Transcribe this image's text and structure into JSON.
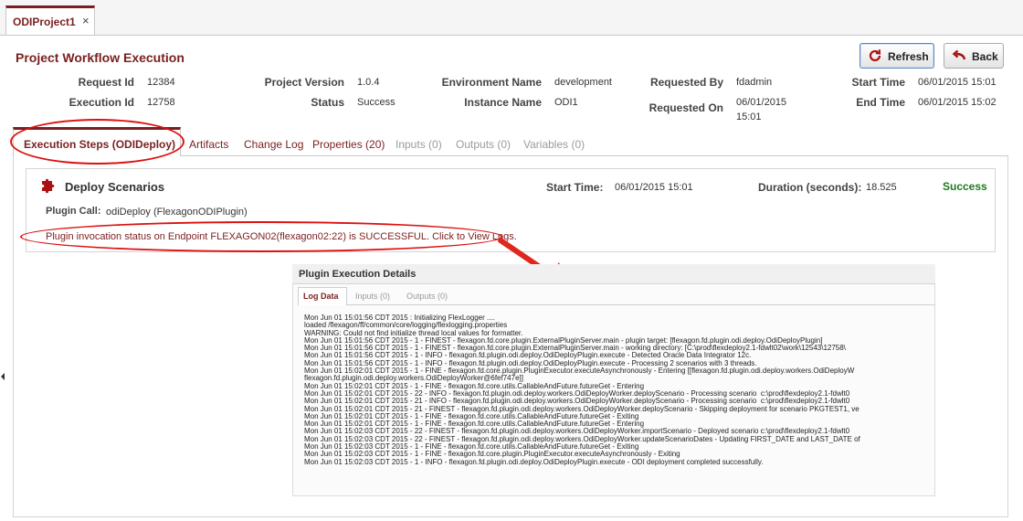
{
  "document_tab": {
    "label": "ODIProject1",
    "close": "×"
  },
  "page_title": "Project Workflow Execution",
  "buttons": {
    "refresh": "Refresh",
    "back": "Back"
  },
  "icons": {
    "refresh": "refresh-icon",
    "back": "back-arrow-icon",
    "step": "puzzle-piece-icon",
    "close": "close-icon"
  },
  "colors": {
    "accent": "#7a1f1f",
    "success": "#1f7a1f",
    "annotation": "#dd1111"
  },
  "summary": {
    "request_id_label": "Request Id",
    "request_id": "12384",
    "execution_id_label": "Execution Id",
    "execution_id": "12758",
    "project_version_label": "Project Version",
    "project_version": "1.0.4",
    "status_label": "Status",
    "status": "Success",
    "environment_name_label": "Environment Name",
    "environment_name": "development",
    "instance_name_label": "Instance Name",
    "instance_name": "ODI1",
    "requested_by_label": "Requested By",
    "requested_by": "fdadmin",
    "requested_on_label": "Requested On",
    "requested_on_date": "06/01/2015",
    "requested_on_time": "15:01",
    "start_time_label": "Start Time",
    "start_time": "06/01/2015 15:01",
    "end_time_label": "End Time",
    "end_time": "06/01/2015 15:02"
  },
  "tabs": [
    "Execution Steps (ODIDeploy)",
    "Artifacts",
    "Change Log",
    "Properties (20)",
    "Inputs (0)",
    "Outputs (0)",
    "Variables (0)"
  ],
  "step": {
    "title": "Deploy Scenarios",
    "start_time_label": "Start Time:",
    "start_time": "06/01/2015 15:01",
    "duration_label": "Duration (seconds):",
    "duration": "18.525",
    "result": "Success",
    "plugin_call_label": "Plugin Call:",
    "plugin_call": "odiDeploy (FlexagonODIPlugin)",
    "status_message": "Plugin invocation status on Endpoint FLEXAGON02(flexagon02:22) is SUCCESSFUL. Click to View Logs."
  },
  "plugin_details": {
    "title": "Plugin Execution Details",
    "tabs": [
      "Log Data",
      "Inputs (0)",
      "Outputs (0)"
    ],
    "log_lines": [
      "Mon Jun 01 15:01:56 CDT 2015 : Initializing FlexLogger ....",
      "loaded /flexagon/ff/common/core/logging/flexlogging.properties",
      "WARNING: Could not find initialize thread local values for formatter.",
      "Mon Jun 01 15:01:56 CDT 2015 - 1 - FINEST - flexagon.fd.core.plugin.ExternalPluginServer.main - plugin target: [flexagon.fd.plugin.odi.deploy.OdiDeployPlugin]",
      "Mon Jun 01 15:01:56 CDT 2015 - 1 - FINEST - flexagon.fd.core.plugin.ExternalPluginServer.main - working directory: [C:\\prod\\flexdeploy2.1-fdwlt02\\work\\12543\\12758\\",
      "Mon Jun 01 15:01:56 CDT 2015 - 1 - INFO - flexagon.fd.plugin.odi.deploy.OdiDeployPlugin.execute - Detected Oracle Data Integrator 12c.",
      "Mon Jun 01 15:01:56 CDT 2015 - 1 - INFO - flexagon.fd.plugin.odi.deploy.OdiDeployPlugin.execute - Processing 2 scenarios with 3 threads.",
      "Mon Jun 01 15:02:01 CDT 2015 - 1 - FINE - flexagon.fd.core.plugin.PluginExecutor.executeAsynchronously - Entering [[flexagon.fd.plugin.odi.deploy.workers.OdiDeployW",
      "flexagon.fd.plugin.odi.deploy.workers.OdiDeployWorker@6fef747e]]",
      "Mon Jun 01 15:02:01 CDT 2015 - 1 - FINE - flexagon.fd.core.utils.CallableAndFuture.futureGet - Entering",
      "Mon Jun 01 15:02:01 CDT 2015 - 22 - INFO - flexagon.fd.plugin.odi.deploy.workers.OdiDeployWorker.deployScenario - Processing scenario  c:\\prod\\flexdeploy2.1-fdwlt0",
      "Mon Jun 01 15:02:01 CDT 2015 - 21 - INFO - flexagon.fd.plugin.odi.deploy.workers.OdiDeployWorker.deployScenario - Processing scenario  c:\\prod\\flexdeploy2.1-fdwlt0",
      "Mon Jun 01 15:02:01 CDT 2015 - 21 - FINEST - flexagon.fd.plugin.odi.deploy.workers.OdiDeployWorker.deployScenario - Skipping deployment for scenario PKGTEST1, ve",
      "Mon Jun 01 15:02:01 CDT 2015 - 1 - FINE - flexagon.fd.core.utils.CallableAndFuture.futureGet - Exiting",
      "Mon Jun 01 15:02:01 CDT 2015 - 1 - FINE - flexagon.fd.core.utils.CallableAndFuture.futureGet - Entering",
      "Mon Jun 01 15:02:03 CDT 2015 - 22 - FINEST - flexagon.fd.plugin.odi.deploy.workers.OdiDeployWorker.importScenario - Deployed scenario c:\\prod\\flexdeploy2.1-fdwlt0",
      "Mon Jun 01 15:02:03 CDT 2015 - 22 - FINEST - flexagon.fd.plugin.odi.deploy.workers.OdiDeployWorker.updateScenarioDates - Updating FIRST_DATE and LAST_DATE of",
      "Mon Jun 01 15:02:03 CDT 2015 - 1 - FINE - flexagon.fd.core.utils.CallableAndFuture.futureGet - Exiting",
      "Mon Jun 01 15:02:03 CDT 2015 - 1 - FINE - flexagon.fd.core.plugin.PluginExecutor.executeAsynchronously - Exiting",
      "Mon Jun 01 15:02:03 CDT 2015 - 1 - INFO - flexagon.fd.plugin.odi.deploy.OdiDeployPlugin.execute - ODI deployment completed successfully."
    ]
  }
}
